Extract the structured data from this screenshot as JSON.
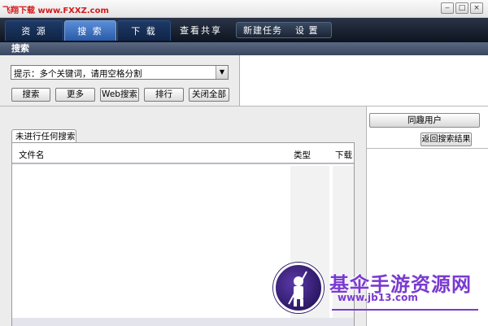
{
  "titlebar": {
    "watermark": "飞翔下载 www.FXXZ.com",
    "min": "‒",
    "max": "□",
    "close": "×"
  },
  "nav": {
    "tabs": [
      {
        "label": "资 源"
      },
      {
        "label": "搜 索"
      },
      {
        "label": "下 载"
      },
      {
        "label": "查看共享"
      }
    ],
    "group": [
      {
        "label": "新建任务"
      },
      {
        "label": "设 置"
      }
    ]
  },
  "search": {
    "section_title": "搜索",
    "input_value": "提示：多个关键词，请用空格分割",
    "buttons": {
      "search": "搜索",
      "more": "更多",
      "web": "Web搜索",
      "rank": "排行",
      "close_all": "关闭全部"
    }
  },
  "results": {
    "tab_label": "未进行任何搜索",
    "columns": [
      "文件名",
      "类型",
      "下载"
    ]
  },
  "right_panel": {
    "peers_button": "同趣用户",
    "back_button": "返回搜索结果"
  },
  "watermark": {
    "title": "基伞手游资源网",
    "subtitle": "www.jb13.com"
  },
  "colors": {
    "nav_active": "#3a72c8",
    "section_header": "#4a5670",
    "watermark": "#7a3ad0"
  }
}
